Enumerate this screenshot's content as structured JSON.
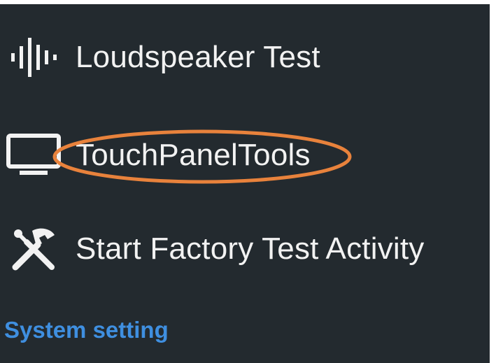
{
  "menu": {
    "items": [
      {
        "label": "Loudspeaker Test",
        "icon": "soundwave-icon"
      },
      {
        "label": "TouchPanelTools",
        "icon": "monitor-icon",
        "highlighted": true
      },
      {
        "label": "Start Factory Test Activity",
        "icon": "tools-icon"
      }
    ]
  },
  "section": {
    "header": "System setting"
  },
  "colors": {
    "background": "#232a2f",
    "text": "#f2f2f2",
    "section_header": "#3f8fe0",
    "highlight": "#e8823c"
  }
}
